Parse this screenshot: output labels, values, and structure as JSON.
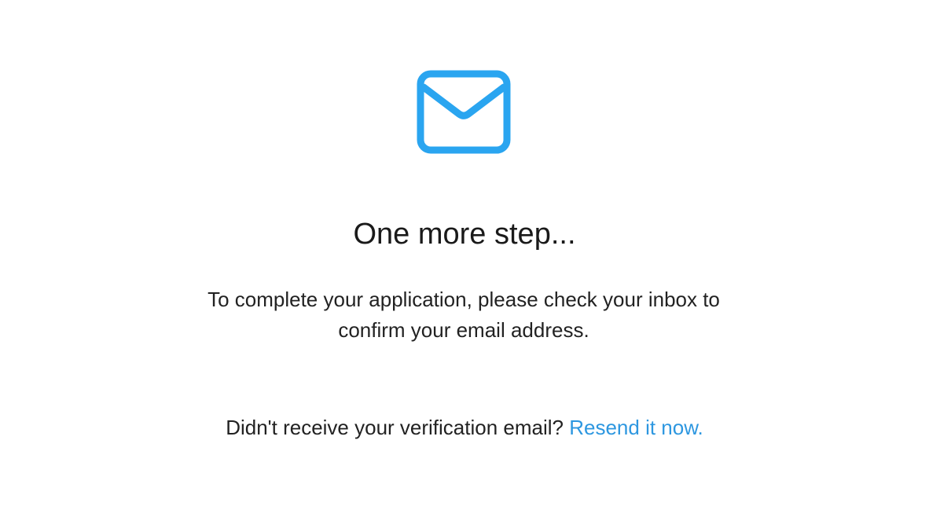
{
  "icon": {
    "name": "envelope-icon",
    "color": "#2aa5f0"
  },
  "heading": "One more step...",
  "message": {
    "line1": "To complete your application, please check your inbox to",
    "line2": "confirm your email address."
  },
  "resend": {
    "prompt": "Didn't receive your verification email?",
    "link_label": "Resend it now.",
    "link_color": "#2d97e0"
  }
}
